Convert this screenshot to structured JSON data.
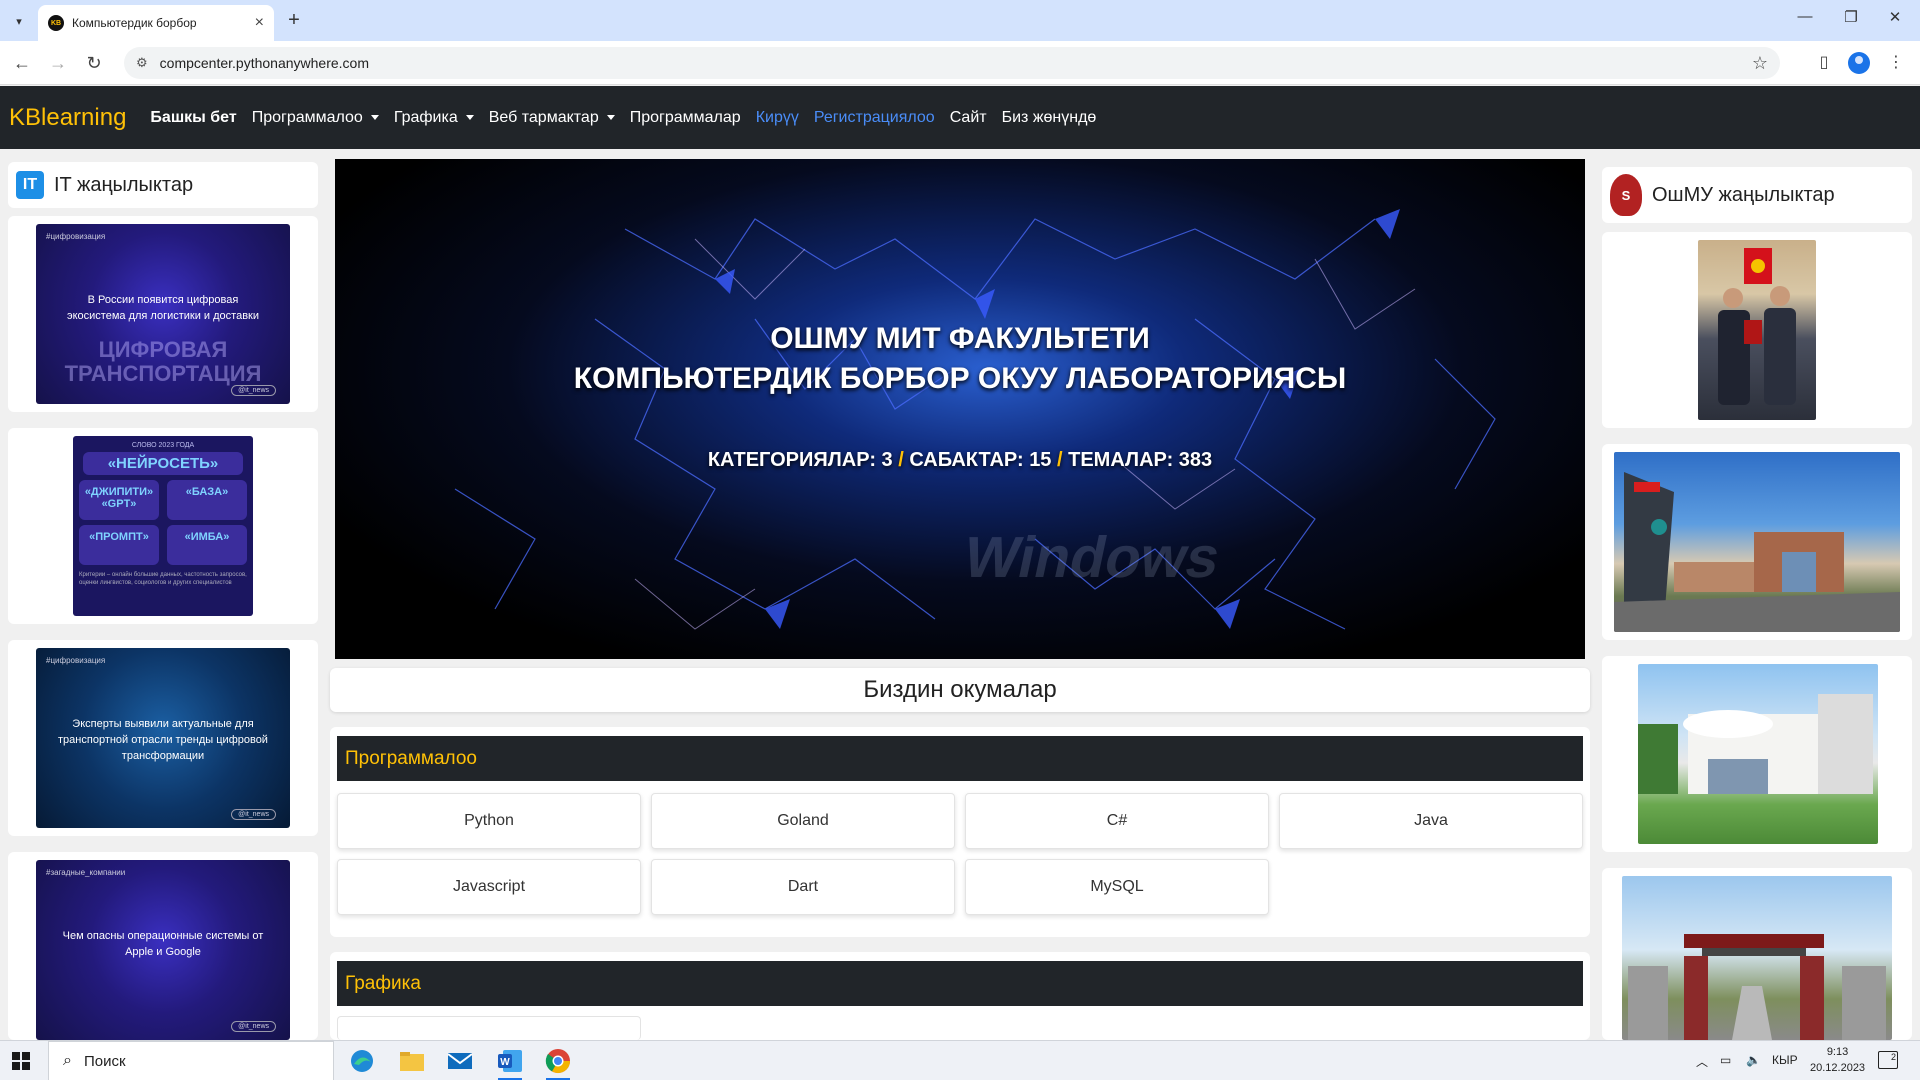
{
  "browser": {
    "tab_title": "Компьютердик борбор",
    "favicon_text": "KB",
    "url": "compcenter.pythonanywhere.com"
  },
  "navbar": {
    "brand": "KBlearning",
    "links": [
      {
        "label": "Башкы бет",
        "style": "bold"
      },
      {
        "label": "Программалоо",
        "dropdown": true
      },
      {
        "label": "Графика",
        "dropdown": true
      },
      {
        "label": "Веб тармактар",
        "dropdown": true
      },
      {
        "label": "Программалар"
      },
      {
        "label": "Кирүү",
        "style": "blue"
      },
      {
        "label": "Регистрациялоо",
        "style": "blue"
      },
      {
        "label": "Сайт"
      },
      {
        "label": "Биз жөнүндө"
      }
    ]
  },
  "left_sidebar": {
    "title": "IT жаңылыктар",
    "logo_text": "IT",
    "news": [
      {
        "tag": "#цифровизация",
        "text": "В России появится цифровая экосистема для логистики и доставки",
        "big_text": "ЦИФРОВАЯ ТРАНСПОРТАЦИЯ",
        "badge": "@it_news"
      },
      {
        "head": "СЛОВО 2023 ГОДА",
        "main": "«НЕЙРОСЕТЬ»",
        "cells": [
          "«ДЖИПИТИ» «GPT»",
          "«БАЗА»",
          "«ПРОМПТ»",
          "«ИМБА»"
        ],
        "foot": "Критерии – онлайн большие данных, частотность запросов, оценки лингвистов, социологов и других специалистов"
      },
      {
        "tag": "#цифровизация",
        "text": "Эксперты выявили актуальные для транспортной отрасли тренды цифровой трансформации",
        "badge": "@it_news"
      },
      {
        "tag": "#загадные_компании",
        "text": "Чем опасны операционные системы от Apple и Google",
        "badge": "@it_news"
      }
    ]
  },
  "hero": {
    "title_line1": "ОШМУ МИТ ФАКУЛЬТЕТИ",
    "title_line2": "КОМПЬЮТЕРДИК БОРБОР ОКУУ ЛАБОРАТОРИЯСЫ",
    "stat1": "КАТЕГОРИЯЛАР: 3",
    "stat2": "САБАКТАР: 15",
    "stat3": "ТЕМАЛАР: 383",
    "separator": "/",
    "watermark": "Windows"
  },
  "courses": {
    "title": "Биздин окумалар",
    "sections": [
      {
        "name": "Программалоо",
        "items": [
          "Python",
          "Goland",
          "C#",
          "Java",
          "Javascript",
          "Dart",
          "MySQL"
        ]
      },
      {
        "name": "Графика",
        "items": []
      }
    ]
  },
  "right_sidebar": {
    "title": "ОшМУ жаңылыктар"
  },
  "taskbar": {
    "search_placeholder": "Поиск",
    "lang": "КЫР",
    "time": "9:13",
    "date": "20.12.2023",
    "notif_count": "2"
  },
  "colors": {
    "accent": "#ffc107",
    "navbar_bg": "#212529",
    "link_blue": "#4a8df8"
  }
}
